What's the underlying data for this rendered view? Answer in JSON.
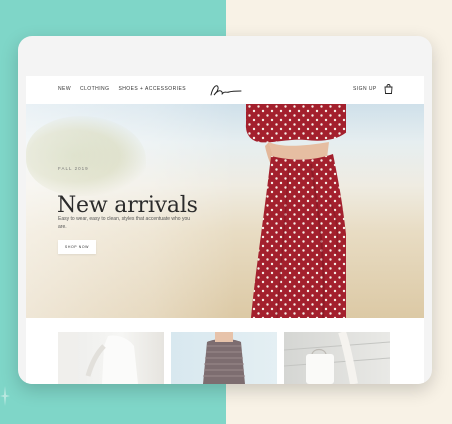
{
  "nav": {
    "links": [
      "NEW",
      "CLOTHING",
      "SHOES + ACCESSORIES"
    ],
    "signup": "SIGN UP",
    "logo_icon": "signature-logo",
    "bag_icon": "shopping-bag-icon"
  },
  "hero": {
    "eyebrow": "FALL 2019",
    "title": "New arrivals",
    "subtitle": "Easy to wear, easy to clean, styles that accentuate who you are.",
    "button": "SHOP NOW"
  },
  "colors": {
    "accent_left": "#7fd6c8",
    "accent_right": "#f8f2e6",
    "dress": "#a8202e"
  }
}
